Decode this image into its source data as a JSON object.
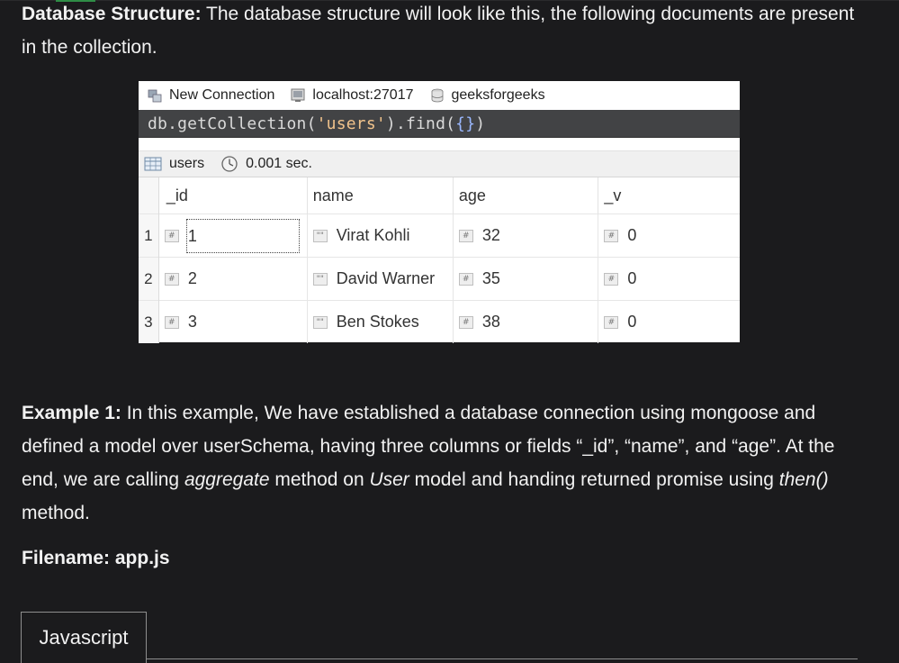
{
  "intro": {
    "bold": "Database Structure:",
    "text": " The database structure will look like this, the following documents are present in the collection."
  },
  "screenshot": {
    "connection": {
      "name": "New Connection",
      "host": "localhost:27017",
      "db": "geeksforgeeks"
    },
    "query": {
      "prefix": "db.getCollection(",
      "arg": "'users'",
      "mid": ").find(",
      "obj": "{}",
      "end": ")"
    },
    "result": {
      "collection": "users",
      "time": "0.001 sec."
    },
    "columns": [
      "_id",
      "name",
      "age",
      "_v"
    ],
    "rows": [
      {
        "num": "1",
        "id": "1",
        "name": "Virat Kohli",
        "age": "32",
        "v": "0"
      },
      {
        "num": "2",
        "id": "2",
        "name": "David Warner",
        "age": "35",
        "v": "0"
      },
      {
        "num": "3",
        "id": "3",
        "name": "Ben Stokes",
        "age": "38",
        "v": "0"
      }
    ],
    "badges": {
      "number": "#",
      "string": "\"\""
    }
  },
  "example": {
    "bold": "Example 1:",
    "t1": " In this example, We have established a database connection using mongoose and defined a model over userSchema, having three columns or fields “_id”, “name”, and “age”. At the end, we are calling ",
    "i1": "aggregate",
    "t2": " method on ",
    "i2": "User",
    "t3": " model and handing returned promise using ",
    "i3": "then()",
    "t4": " method."
  },
  "filename": "Filename: app.js",
  "tab": {
    "label": "Javascript"
  }
}
